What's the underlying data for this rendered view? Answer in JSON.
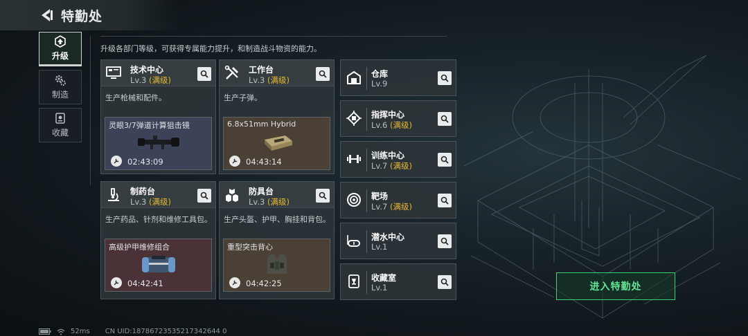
{
  "header": {
    "title": "特勤处"
  },
  "sidenav": [
    {
      "label": "升级",
      "active": true,
      "icon": "upgrade-icon"
    },
    {
      "label": "制造",
      "active": false,
      "icon": "gears-icon"
    },
    {
      "label": "收藏",
      "active": false,
      "icon": "collection-icon"
    }
  ],
  "description": "升级各部门等级，可获得专属能力提升，和制造战斗物资的能力。",
  "cards": [
    {
      "name": "技术中心",
      "level": "Lv.3",
      "max": "(满级)",
      "desc": "生产枪械和配件。",
      "product": "灵眼3/7弹道计算狙击镜",
      "time": "02:43:09",
      "icon": "monitor-icon",
      "prod_color": "#3c4258"
    },
    {
      "name": "工作台",
      "level": "Lv.3",
      "max": "(满级)",
      "desc": "生产子弹。",
      "product": "6.8x51mm Hybrid",
      "time": "04:43:14",
      "icon": "tools-icon",
      "prod_color": "#4b4036"
    },
    {
      "name": "制药台",
      "level": "Lv.3",
      "max": "(满级)",
      "desc": "生产药品、针剂和维修工具包。",
      "product": "高级护甲维修组合",
      "time": "04:42:41",
      "icon": "microscope-icon",
      "prod_color": "#4a3237"
    },
    {
      "name": "防具台",
      "level": "Lv.3",
      "max": "(满级)",
      "desc": "生产头盔、护甲、胸挂和背包。",
      "product": "重型突击背心",
      "time": "04:42:25",
      "icon": "armor-icon",
      "prod_color": "#4b4036"
    }
  ],
  "rows": [
    {
      "name": "仓库",
      "level": "Lv.9",
      "max": "",
      "icon": "warehouse-icon"
    },
    {
      "name": "指挥中心",
      "level": "Lv.6",
      "max": "(满级)",
      "icon": "chip-icon"
    },
    {
      "name": "训练中心",
      "level": "Lv.7",
      "max": "(满级)",
      "icon": "dumbbell-icon"
    },
    {
      "name": "靶场",
      "level": "Lv.7",
      "max": "(满级)",
      "icon": "target-icon"
    },
    {
      "name": "潜水中心",
      "level": "Lv.1",
      "max": "",
      "icon": "diving-mask-icon"
    },
    {
      "name": "收藏室",
      "level": "Lv.1",
      "max": "",
      "icon": "trophy-icon"
    }
  ],
  "enter_button": "进入特勤处",
  "status": {
    "ping": "52ms",
    "uid": "CN UID:18786723535217342644 0"
  },
  "colors": {
    "accent_green": "#3fd07a",
    "max_gold": "#e8b830"
  }
}
